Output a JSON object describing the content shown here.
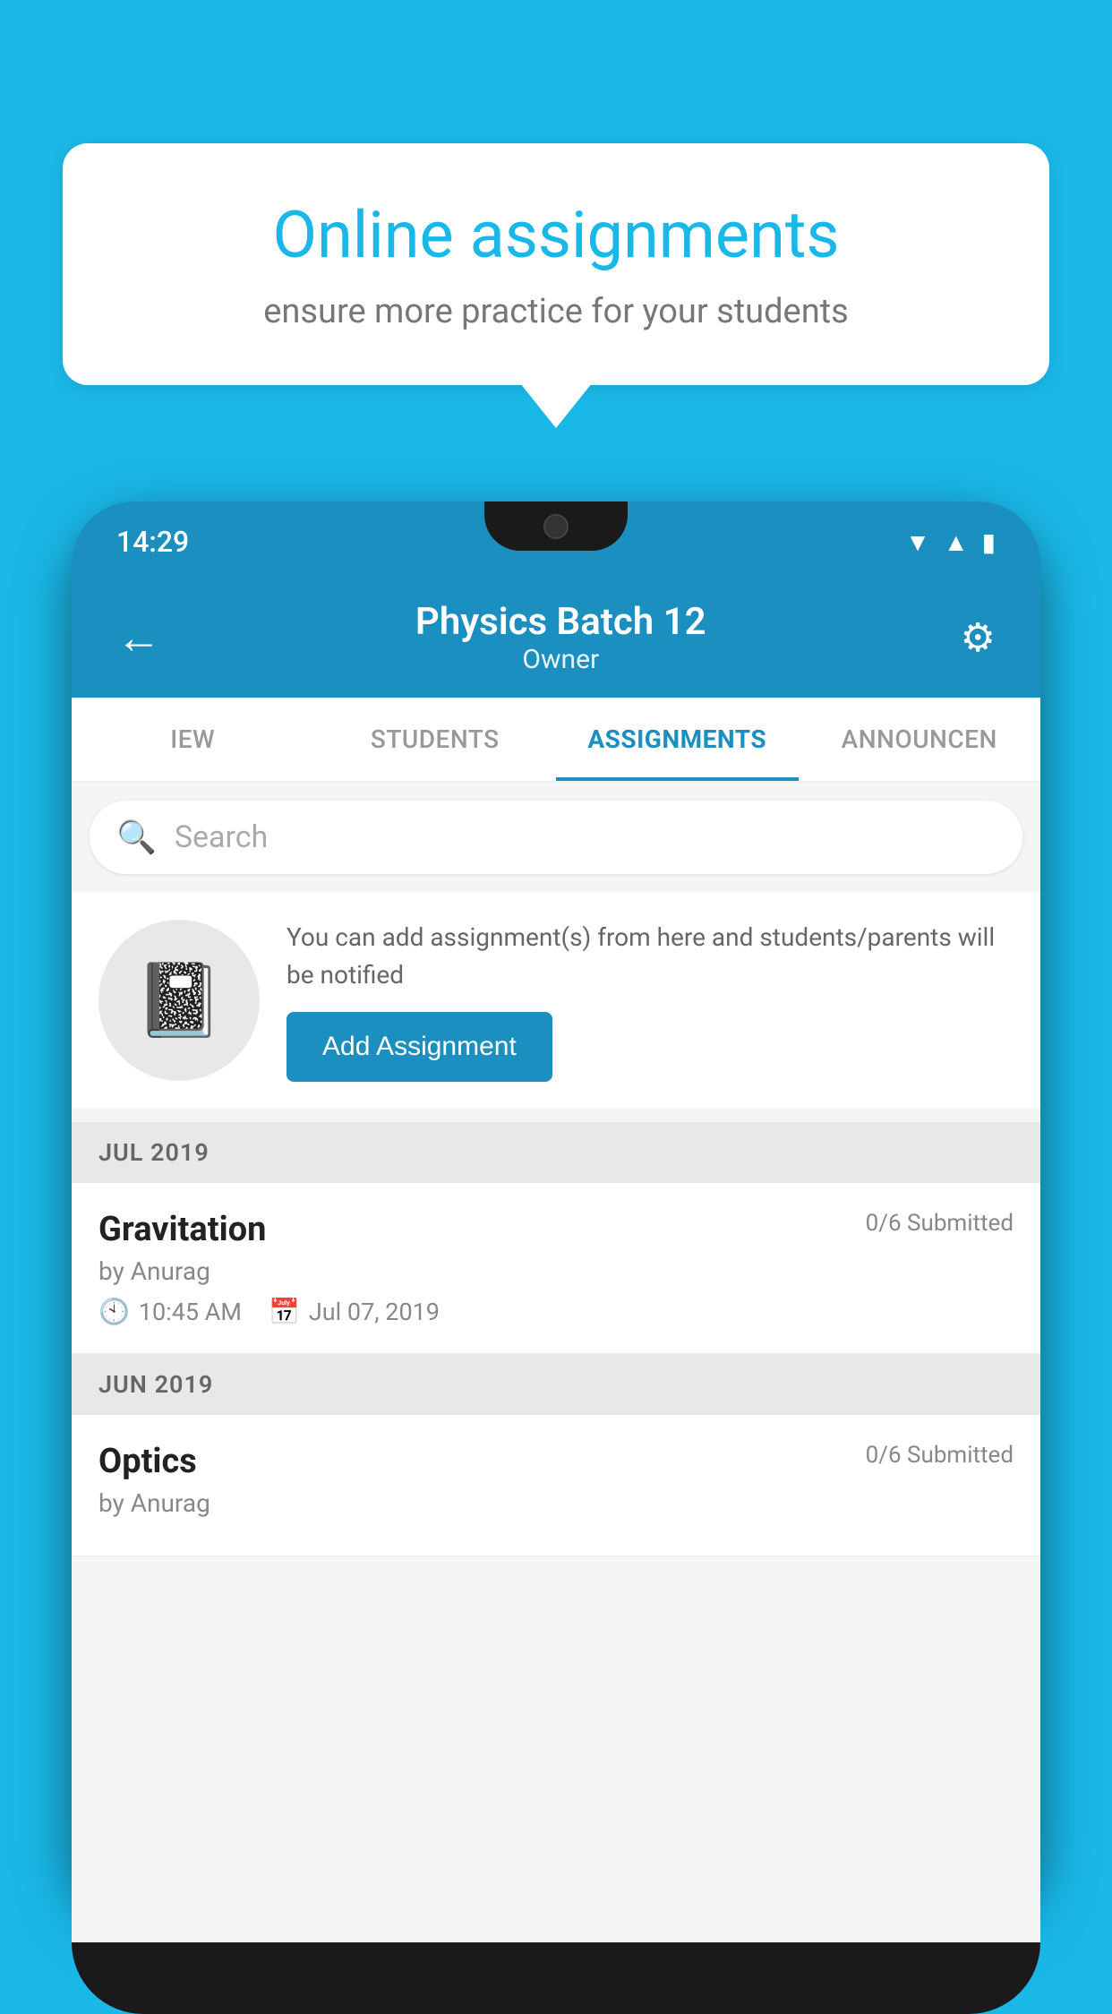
{
  "background_color": "#1ab8e8",
  "speech_bubble": {
    "title": "Online assignments",
    "subtitle": "ensure more practice for your students"
  },
  "phone": {
    "status_time": "14:29",
    "header": {
      "back_label": "←",
      "title": "Physics Batch 12",
      "subtitle": "Owner",
      "settings_label": "⚙"
    },
    "tabs": [
      {
        "label": "IEW",
        "active": false
      },
      {
        "label": "STUDENTS",
        "active": false
      },
      {
        "label": "ASSIGNMENTS",
        "active": true
      },
      {
        "label": "ANNOUNCEN",
        "active": false
      }
    ],
    "search": {
      "placeholder": "Search"
    },
    "promo": {
      "description": "You can add assignment(s) from here and students/parents will be notified",
      "button_label": "Add Assignment"
    },
    "sections": [
      {
        "label": "JUL 2019",
        "assignments": [
          {
            "title": "Gravitation",
            "submitted": "0/6 Submitted",
            "author": "by Anurag",
            "time": "10:45 AM",
            "date": "Jul 07, 2019"
          }
        ]
      },
      {
        "label": "JUN 2019",
        "assignments": [
          {
            "title": "Optics",
            "submitted": "0/6 Submitted",
            "author": "by Anurag",
            "time": "",
            "date": ""
          }
        ]
      }
    ]
  }
}
